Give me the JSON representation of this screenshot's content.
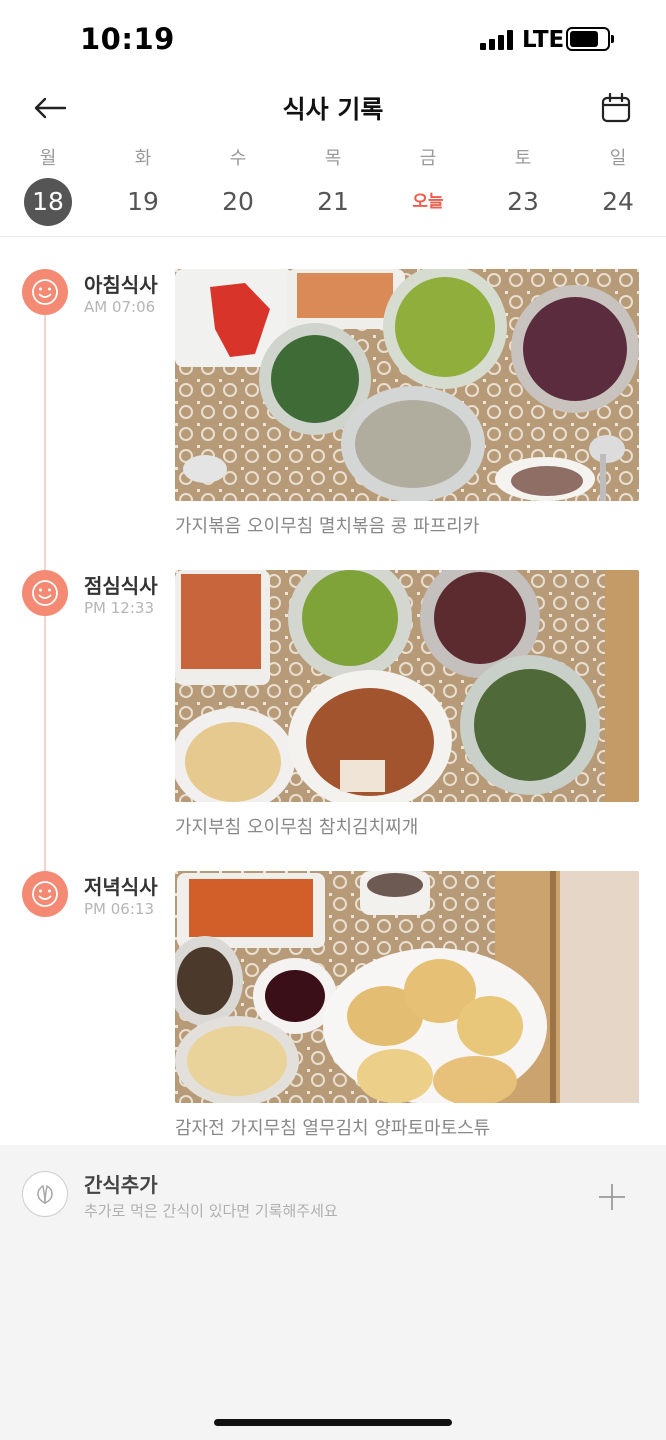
{
  "status_bar": {
    "time": "10:19",
    "network": "LTE",
    "battery_level": 0.65
  },
  "header": {
    "title": "식사 기록",
    "back_icon": "arrow-left-icon",
    "calendar_icon": "calendar-icon"
  },
  "week": [
    {
      "dow": "월",
      "date": "18",
      "selected": true
    },
    {
      "dow": "화",
      "date": "19"
    },
    {
      "dow": "수",
      "date": "20"
    },
    {
      "dow": "목",
      "date": "21"
    },
    {
      "dow": "금",
      "date": "오늘",
      "today": true
    },
    {
      "dow": "토",
      "date": "23"
    },
    {
      "dow": "일",
      "date": "24"
    }
  ],
  "meals": [
    {
      "title": "아침식사",
      "time": "AM 07:06",
      "menu": "가지볶음 오이무침 멸치볶음 콩 파프리카",
      "icon": "smile-icon"
    },
    {
      "title": "점심식사",
      "time": "PM 12:33",
      "menu": "가지부침 오이무침 참치김치찌개",
      "icon": "smile-icon"
    },
    {
      "title": "저녁식사",
      "time": "PM 06:13",
      "menu": "감자전 가지무침 열무김치 양파토마토스튜",
      "icon": "smile-icon"
    }
  ],
  "snack": {
    "title": "간식추가",
    "subtitle": "추가로 먹은 간식이 있다면 기록해주세요",
    "icon": "leaf-icon",
    "add_icon": "plus-icon"
  },
  "colors": {
    "accent": "#ef5d4c",
    "meal_icon": "#f48a74",
    "selected_day": "#555555"
  }
}
